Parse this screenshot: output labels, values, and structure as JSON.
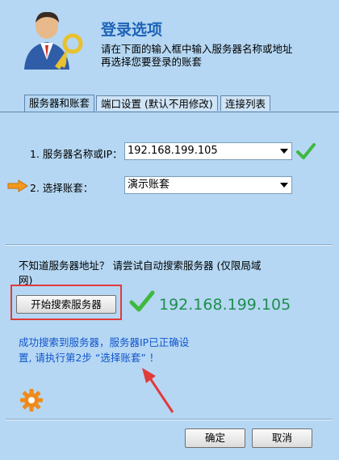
{
  "header": {
    "title": "登录选项",
    "desc_line1": "请在下面的输入框中输入服务器名称或地址",
    "desc_line2": "再选择您要登录的账套"
  },
  "tabs": [
    {
      "label": "服务器和账套",
      "active": true
    },
    {
      "label": "端口设置 (默认不用修改)",
      "active": false
    },
    {
      "label": "连接列表",
      "active": false
    }
  ],
  "form": {
    "server_label": "1. 服务器名称或IP：",
    "server_value": "192.168.199.105",
    "account_label": "2. 选择账套：",
    "account_value": "演示账套"
  },
  "autosearch": {
    "hint_line1": "不知道服务器地址？ 请尝试自动搜索服务器 (仅限局域",
    "hint_line2": "网)",
    "button_label": "开始搜索服务器",
    "found_ip": "192.168.199.105",
    "status_line1": "成功搜索到服务器，服务器IP已正确设",
    "status_line2": "置, 请执行第2步 “选择账套” ！"
  },
  "footer": {
    "ok_label": "确定",
    "cancel_label": "取消"
  },
  "icons": {
    "header": "user-key-icon",
    "check": "check-icon",
    "arrow": "orange-arrow-icon",
    "gear": "gear-icon"
  },
  "colors": {
    "background": "#b5d7f3",
    "title": "#1e63b8",
    "ip_text": "#1e8f4e",
    "status_text": "#1155cc",
    "highlight_box": "#e03a3a",
    "annotation_arrow": "#e03a3a",
    "check": "#3fb83f"
  }
}
